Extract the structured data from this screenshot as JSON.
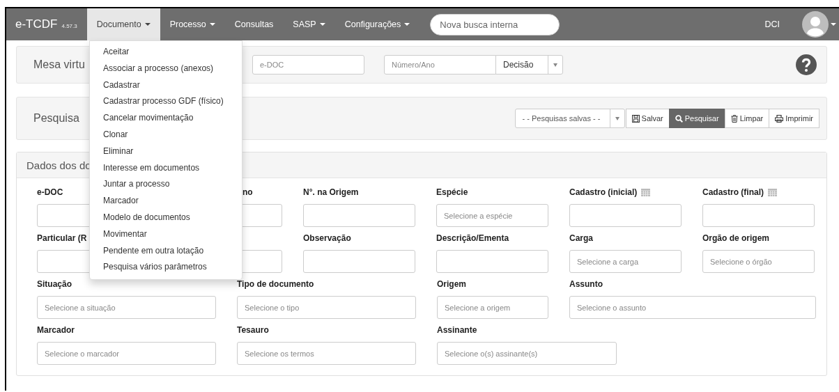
{
  "navbar": {
    "brand": "e-TCDF",
    "version": "4.57.3",
    "items": [
      {
        "label": "Documento",
        "dropdown": true,
        "selected": true
      },
      {
        "label": "Processo",
        "dropdown": true,
        "selected": false
      },
      {
        "label": "Consultas",
        "dropdown": false,
        "selected": false
      },
      {
        "label": "SASP",
        "dropdown": true,
        "selected": false
      },
      {
        "label": "Configurações",
        "dropdown": true,
        "selected": false
      }
    ],
    "search": {
      "placeholder": "Nova busca interna"
    },
    "user": "DCI"
  },
  "dropdown_menu": [
    "Aceitar",
    "Associar a processo (anexos)",
    "Cadastrar",
    "Cadastrar processo GDF (físico)",
    "Cancelar movimentação",
    "Clonar",
    "Eliminar",
    "Interesse em documentos",
    "Juntar a processo",
    "Marcador",
    "Modelo de documentos",
    "Movimentar",
    "Pendente em outra lotação",
    "Pesquisa vários parâmetros"
  ],
  "mesa_panel": {
    "title": "Mesa virtu",
    "edoc": {
      "placeholder": "e-DOC"
    },
    "numero": {
      "placeholder": "Número/Ano"
    },
    "decisao": "Decisão"
  },
  "search_panel": {
    "title": "Pesquisa",
    "saved": "- - Pesquisas salvas - -",
    "buttons": [
      {
        "label": "Salvar",
        "primary": false
      },
      {
        "label": "Pesquisar",
        "primary": true
      },
      {
        "label": "Limpar",
        "primary": false
      },
      {
        "label": "Imprimir",
        "primary": false
      }
    ]
  },
  "data_panel": {
    "title": "Dados dos do",
    "grid_rows": [
      [
        {
          "label": "e-DOC"
        },
        {
          "label": "no"
        },
        {
          "label": "N°. na Origem"
        },
        {
          "label": "Espécie",
          "placeholder": "Selecione a espécie"
        },
        {
          "label": "Cadastro (inicial)",
          "calendar": true
        },
        {
          "label": "Cadastro (final)",
          "calendar": true
        }
      ],
      [
        {
          "label": "Particular (R"
        },
        {},
        {
          "label": "Observação"
        },
        {
          "label": "Descrição/Ementa"
        },
        {
          "label": "Carga",
          "placeholder": "Selecione a carga"
        },
        {
          "label": "Orgão de origem",
          "placeholder": "Selecione o órgão"
        }
      ]
    ],
    "lower_rows": [
      [
        {
          "label": "Situação",
          "placeholder": "Selecione a situação"
        },
        {
          "label": "Tipo de documento",
          "placeholder": "Selecione o tipo"
        },
        {
          "label": "Origem",
          "placeholder": "Selecione a origem"
        },
        {
          "label": "Assunto",
          "placeholder": "Selecione o assunto"
        }
      ],
      [
        {
          "label": "Marcador",
          "placeholder": "Selecione o marcador"
        },
        {
          "label": "Tesauro",
          "placeholder": "Selecione os termos"
        },
        {
          "label": "Assinante",
          "placeholder": "Selecione o(s) assinante(s)"
        }
      ]
    ]
  }
}
